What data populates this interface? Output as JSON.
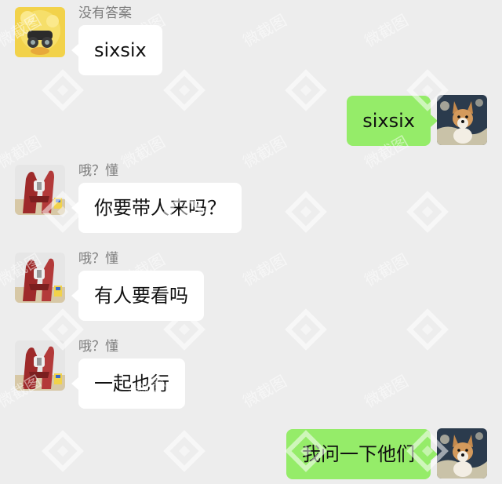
{
  "colors": {
    "background": "#ededed",
    "incoming_bubble": "#ffffff",
    "outgoing_bubble": "#95ec69",
    "sender_name": "#7d7d7d"
  },
  "watermark_text": "微截图",
  "messages": [
    {
      "direction": "in",
      "sender": "没有答案",
      "text": "sixsix",
      "avatar_icon": "yellow-duck-binoculars-avatar-icon"
    },
    {
      "direction": "out",
      "sender": "",
      "text": "sixsix",
      "avatar_icon": "corgi-dog-avatar-icon"
    },
    {
      "direction": "in",
      "sender": "哦？懂",
      "text": "你要带人来吗？",
      "avatar_icon": "red-robot-avatar-icon"
    },
    {
      "direction": "in",
      "sender": "哦？懂",
      "text": "有人要看吗",
      "avatar_icon": "red-robot-avatar-icon"
    },
    {
      "direction": "in",
      "sender": "哦？懂",
      "text": "一起也行",
      "avatar_icon": "red-robot-avatar-icon"
    },
    {
      "direction": "out",
      "sender": "",
      "text": "我问一下他们",
      "avatar_icon": "corgi-dog-avatar-icon"
    }
  ]
}
